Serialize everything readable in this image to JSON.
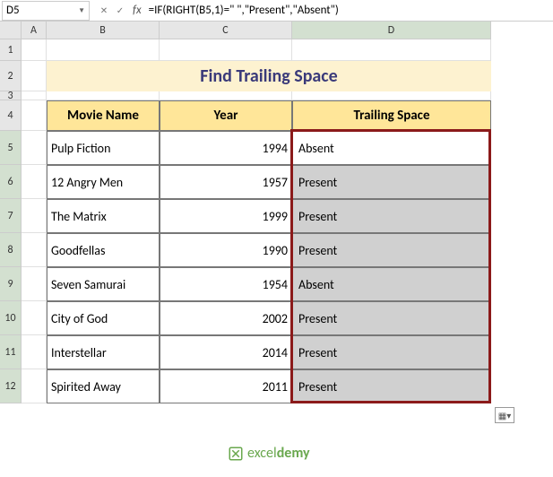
{
  "nameBox": "D5",
  "formulaBar": "=IF(RIGHT(B5,1)=\" \",\"Present\",\"Absent\")",
  "columns": [
    "A",
    "B",
    "C",
    "D"
  ],
  "rows": [
    "1",
    "2",
    "3",
    "4",
    "5",
    "6",
    "7",
    "8",
    "9",
    "10",
    "11",
    "12"
  ],
  "title": "Find Trailing Space",
  "headers": {
    "b": "Movie Name",
    "c": "Year",
    "d": "Trailing Space"
  },
  "data": [
    {
      "b": " Pulp  Fiction",
      "c": "1994",
      "d": "Absent"
    },
    {
      "b": " 12 Angry Men",
      "c": "1957",
      "d": "Present"
    },
    {
      "b": "The Matrix",
      "c": "1999",
      "d": "Present"
    },
    {
      "b": " Goodfellas",
      "c": "1990",
      "d": "Present"
    },
    {
      "b": "Seven Samurai",
      "c": "1954",
      "d": "Absent"
    },
    {
      "b": " City of God",
      "c": "2002",
      "d": "Present"
    },
    {
      "b": "Interstellar",
      "c": "2014",
      "d": "Present"
    },
    {
      "b": " Spirited Away",
      "c": "2011",
      "d": "Present"
    }
  ],
  "logo": {
    "brand": "excel",
    "suffix": "demy"
  },
  "chart_data": {
    "type": "table",
    "title": "Find Trailing Space",
    "columns": [
      "Movie Name",
      "Year",
      "Trailing Space"
    ],
    "rows": [
      [
        " Pulp  Fiction",
        1994,
        "Absent"
      ],
      [
        " 12 Angry Men",
        1957,
        "Present"
      ],
      [
        "The Matrix",
        1999,
        "Present"
      ],
      [
        " Goodfellas",
        1990,
        "Present"
      ],
      [
        "Seven Samurai",
        1954,
        "Absent"
      ],
      [
        " City of God",
        2002,
        "Present"
      ],
      [
        "Interstellar",
        2014,
        "Present"
      ],
      [
        " Spirited Away",
        2011,
        "Present"
      ]
    ]
  }
}
